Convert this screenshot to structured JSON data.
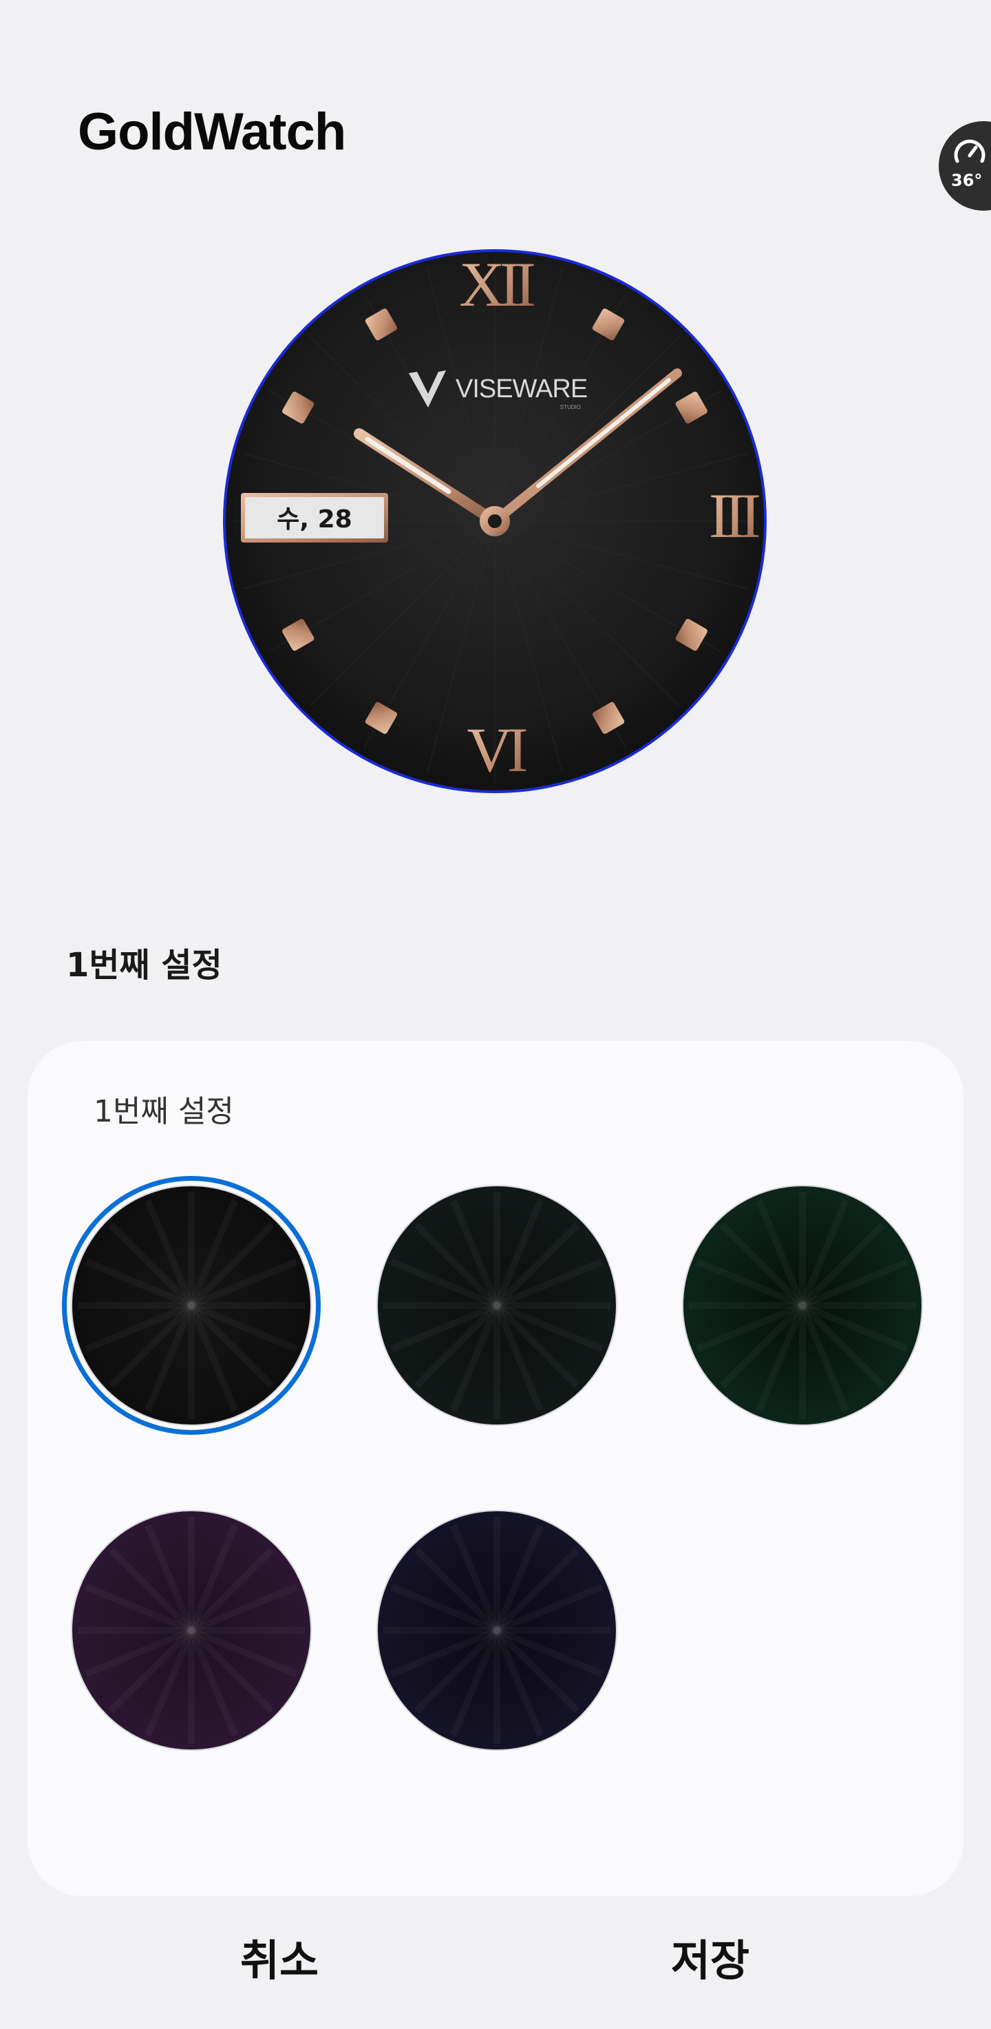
{
  "app": {
    "title": "GoldWatch"
  },
  "fps_badge": {
    "value": "36°"
  },
  "preview": {
    "brand": "VISEWARE",
    "brand_sub": "STUDIO",
    "date": "수, 28",
    "numerals": {
      "top": "XII",
      "right": "III",
      "bottom": "VI"
    },
    "colors": {
      "dial": "#1b1b1b",
      "accent": "#c9967a",
      "ring": "#1a2bd6"
    }
  },
  "settings": {
    "section_title": "1번째 설정",
    "card_title": "1번째 설정",
    "selected_index": 0,
    "options": [
      {
        "name": "black",
        "center": "#151515",
        "edge": "#0e0e0e"
      },
      {
        "name": "dark-gray-green",
        "center": "#0c100f",
        "edge": "#121817"
      },
      {
        "name": "dark-green",
        "center": "#041009",
        "edge": "#0c251a"
      },
      {
        "name": "dark-purple",
        "center": "#1c0f1f",
        "edge": "#2c1732"
      },
      {
        "name": "dark-navy",
        "center": "#0a0912",
        "edge": "#151327"
      }
    ]
  },
  "actions": {
    "cancel": "취소",
    "save": "저장"
  }
}
